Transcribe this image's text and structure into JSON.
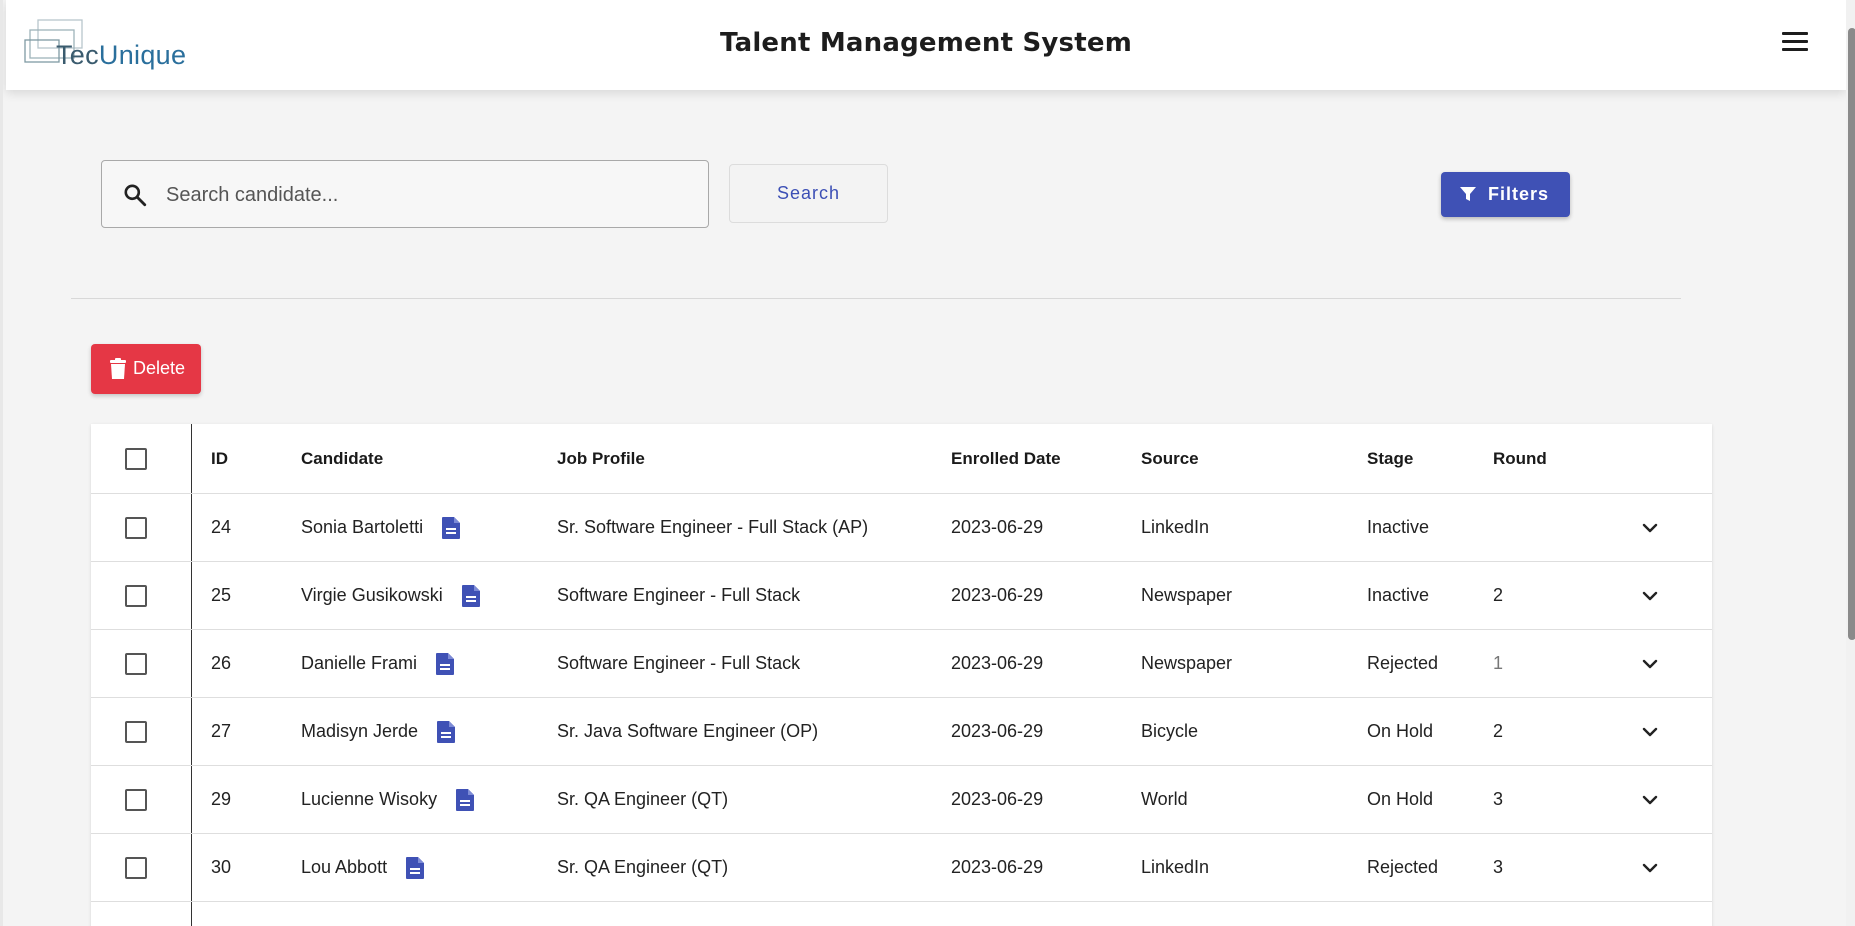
{
  "header": {
    "logo_prefix": "Tec",
    "logo_suffix": "Unique",
    "title": "Talent Management System",
    "menu_icon": "hamburger-menu-icon"
  },
  "search": {
    "placeholder": "Search candidate...",
    "value": "",
    "button_label": "Search"
  },
  "toolbar": {
    "filters_label": "Filters",
    "delete_label": "Delete"
  },
  "colors": {
    "primary": "#3f51b5",
    "danger": "#e53745"
  },
  "table": {
    "columns": [
      "ID",
      "Candidate",
      "Job Profile",
      "Enrolled Date",
      "Source",
      "Stage",
      "Round"
    ],
    "rows": [
      {
        "id": "24",
        "candidate": "Sonia Bartoletti",
        "job": "Sr. Software Engineer - Full Stack (AP)",
        "date": "2023-06-29",
        "source": "LinkedIn",
        "stage": "Inactive",
        "round": ""
      },
      {
        "id": "25",
        "candidate": "Virgie Gusikowski",
        "job": "Software Engineer - Full Stack",
        "date": "2023-06-29",
        "source": "Newspaper",
        "stage": "Inactive",
        "round": "2"
      },
      {
        "id": "26",
        "candidate": "Danielle Frami",
        "job": "Software Engineer - Full Stack",
        "date": "2023-06-29",
        "source": "Newspaper",
        "stage": "Rejected",
        "round": "1"
      },
      {
        "id": "27",
        "candidate": "Madisyn Jerde",
        "job": "Sr. Java Software Engineer (OP)",
        "date": "2023-06-29",
        "source": "Bicycle",
        "stage": "On Hold",
        "round": "2"
      },
      {
        "id": "29",
        "candidate": "Lucienne Wisoky",
        "job": "Sr. QA Engineer (QT)",
        "date": "2023-06-29",
        "source": "World",
        "stage": "On Hold",
        "round": "3"
      },
      {
        "id": "30",
        "candidate": "Lou Abbott",
        "job": "Sr. QA Engineer (QT)",
        "date": "2023-06-29",
        "source": "LinkedIn",
        "stage": "Rejected",
        "round": "3"
      }
    ]
  }
}
